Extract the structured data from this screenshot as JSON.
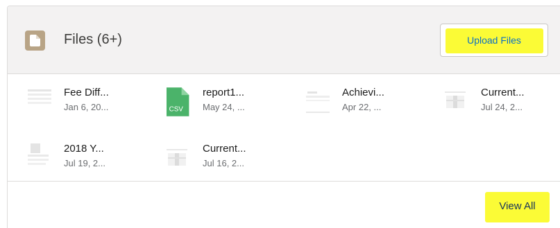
{
  "header": {
    "title": "Files (6+)",
    "icon": "file-icon",
    "upload_label": "Upload Files"
  },
  "files": [
    {
      "name": "Fee Diff...",
      "date": "Jan 6, 20...",
      "thumb": "document-thumbnail"
    },
    {
      "name": "report1...",
      "date": "May 24, ...",
      "thumb": "csv-icon",
      "badge": "CSV"
    },
    {
      "name": "Achievi...",
      "date": "Apr 22, ...",
      "thumb": "document-thumbnail"
    },
    {
      "name": "Current...",
      "date": "Jul 24, 2...",
      "thumb": "document-thumbnail"
    },
    {
      "name": "2018 Y...",
      "date": "Jul 19, 2...",
      "thumb": "document-thumbnail"
    },
    {
      "name": "Current...",
      "date": "Jul 16, 2...",
      "thumb": "document-thumbnail"
    }
  ],
  "footer": {
    "view_all_label": "View All"
  },
  "colors": {
    "highlight": "#fbfb36",
    "header_bg": "#f3f2f2",
    "file_badge": "#b8a486",
    "csv_green": "#4bb36a",
    "link_blue": "#0a6fc6"
  }
}
